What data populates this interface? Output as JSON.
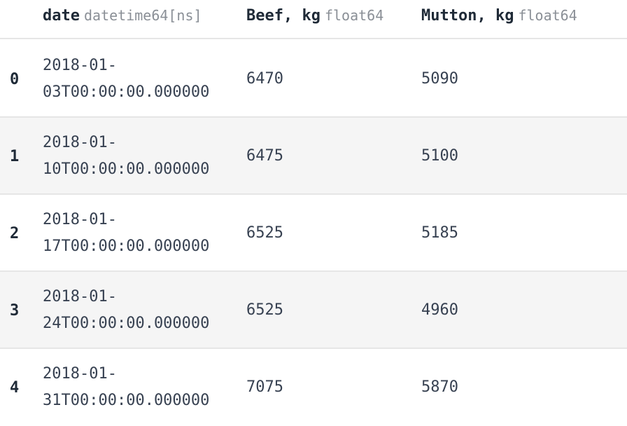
{
  "columns": [
    {
      "name": "date",
      "dtype": "datetime64[ns]"
    },
    {
      "name": "Beef, kg",
      "dtype": "float64"
    },
    {
      "name": "Mutton, kg",
      "dtype": "float64"
    }
  ],
  "rows": [
    {
      "index": "0",
      "date_line1": "2018-01-",
      "date_line2": "03T00:00:00.000000",
      "beef": "6470",
      "mutton": "5090"
    },
    {
      "index": "1",
      "date_line1": "2018-01-",
      "date_line2": "10T00:00:00.000000",
      "beef": "6475",
      "mutton": "5100"
    },
    {
      "index": "2",
      "date_line1": "2018-01-",
      "date_line2": "17T00:00:00.000000",
      "beef": "6525",
      "mutton": "5185"
    },
    {
      "index": "3",
      "date_line1": "2018-01-",
      "date_line2": "24T00:00:00.000000",
      "beef": "6525",
      "mutton": "4960"
    },
    {
      "index": "4",
      "date_line1": "2018-01-",
      "date_line2": "31T00:00:00.000000",
      "beef": "7075",
      "mutton": "5870"
    }
  ]
}
